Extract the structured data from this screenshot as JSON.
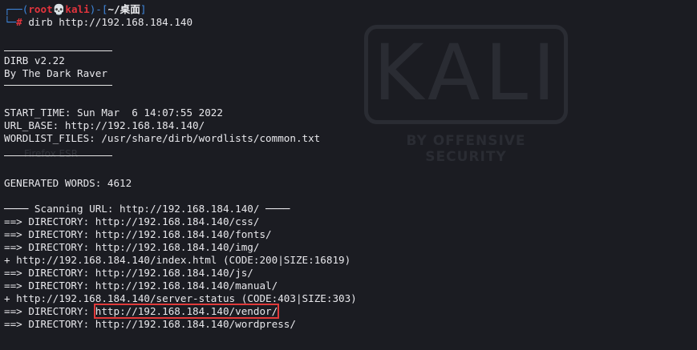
{
  "prompt": {
    "corner_top": "┌──(",
    "user": "root",
    "skull": "💀",
    "host": "kali",
    "path_open": ")-[",
    "path": "~/桌面",
    "path_close": "]",
    "corner_bottom": "└─",
    "hash": "#",
    "command": " dirb http://192.168.184.140"
  },
  "banner": {
    "version": "DIRB v2.22",
    "author": "By The Dark Raver"
  },
  "info": {
    "start_time": "START_TIME: Sun Mar  6 14:07:55 2022",
    "url_base": "URL_BASE: http://192.168.184.140/",
    "wordlist": "WORDLIST_FILES: /usr/share/dirb/wordlists/common.txt"
  },
  "generated_words": "GENERATED WORDS: 4612",
  "scan_header": "──── Scanning URL: http://192.168.184.140/ ────",
  "results": [
    {
      "prefix": "==> DIRECTORY: ",
      "url": "http://192.168.184.140/css/",
      "highlight": false
    },
    {
      "prefix": "==> DIRECTORY: ",
      "url": "http://192.168.184.140/fonts/",
      "highlight": false
    },
    {
      "prefix": "==> DIRECTORY: ",
      "url": "http://192.168.184.140/img/",
      "highlight": false
    },
    {
      "prefix": "+ ",
      "url": "http://192.168.184.140/index.html (CODE:200|SIZE:16819)",
      "highlight": false
    },
    {
      "prefix": "==> DIRECTORY: ",
      "url": "http://192.168.184.140/js/",
      "highlight": false
    },
    {
      "prefix": "==> DIRECTORY: ",
      "url": "http://192.168.184.140/manual/",
      "highlight": false
    },
    {
      "prefix": "+ ",
      "url": "http://192.168.184.140/server-status (CODE:403|SIZE:303)",
      "highlight": false
    },
    {
      "prefix": "==> DIRECTORY: ",
      "url": "http://192.168.184.140/vendor/",
      "highlight": true
    },
    {
      "prefix": "==> DIRECTORY: ",
      "url": "http://192.168.184.140/wordpress/",
      "highlight": false
    }
  ],
  "wallpaper": {
    "logo_text": "KALI",
    "tagline": "BY OFFENSIVE SECURITY",
    "ghost_label": "Firefox ESR"
  },
  "colors": {
    "background": "#1b1c22",
    "prompt_blue": "#3f88de",
    "prompt_red": "#e2343d",
    "highlight_box": "#e03a3a"
  }
}
